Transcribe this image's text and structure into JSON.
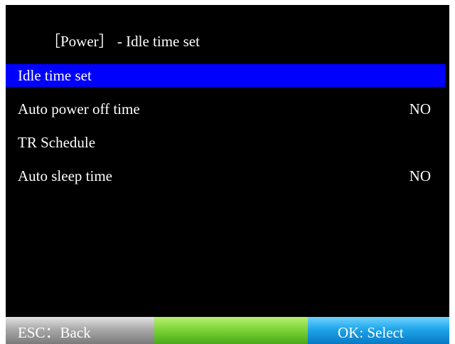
{
  "header": {
    "title": "［Power］ - Idle time set"
  },
  "menu": {
    "items": [
      {
        "label": "Idle time set",
        "value": "",
        "selected": true
      },
      {
        "label": "Auto power off time",
        "value": "NO",
        "selected": false
      },
      {
        "label": "TR Schedule",
        "value": "",
        "selected": false
      },
      {
        "label": "Auto sleep time",
        "value": "NO",
        "selected": false
      }
    ]
  },
  "footer": {
    "esc_label": "ESC：Back",
    "center_label": "",
    "ok_label": "OK: Select"
  },
  "colors": {
    "background": "#000000",
    "selection": "#0000ff",
    "esc_key": "#a0a0a0",
    "center_key": "#7ed63a",
    "ok_key": "#1fa6ea"
  }
}
